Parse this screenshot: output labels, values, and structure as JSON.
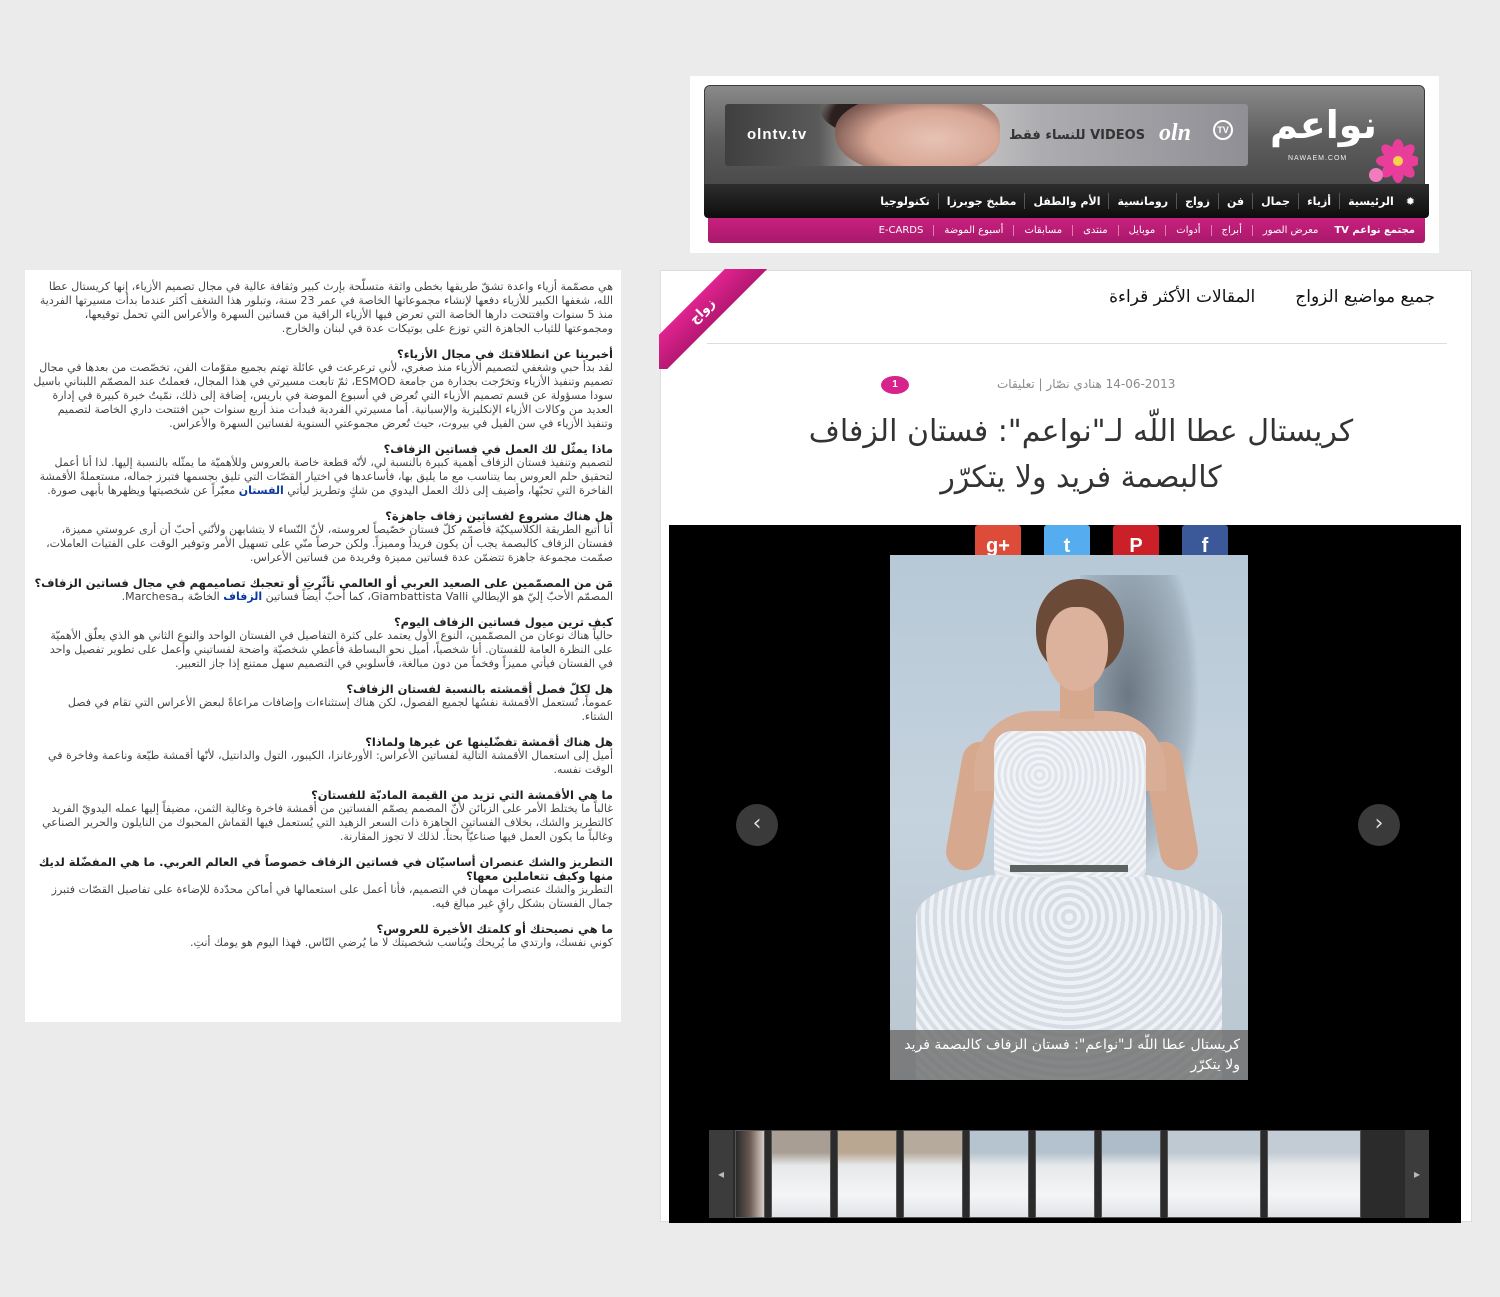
{
  "header": {
    "ad": {
      "site": "olntv.tv",
      "tagline": "VIDEOS للنساء فقط",
      "logo": "oln",
      "tv_badge": "TV"
    },
    "site_logo": "نواعم",
    "site_logo_sub": "NAWAEM.COM",
    "nav_main": [
      "الرئيسية",
      "أزياء",
      "جمال",
      "فن",
      "زواج",
      "رومانسية",
      "الأم والطفل",
      "مطبخ جوبرزا",
      "تكنولوجيا"
    ],
    "nav_sub": {
      "community": "مجتمع نواعم TV",
      "items": [
        "معرض الصور",
        "أبراج",
        "أدوات",
        "موبايل",
        "منتدى",
        "مسابقات",
        "أسبوع الموضة",
        "E-CARDS"
      ]
    }
  },
  "article_text": {
    "intro": "هي مصمّمة أزياء واعدة تشقّ طريقها بخطى واثقة متسلّحة بإرث كبير وثقافة عالية في مجال تصميم الأزياء، إنها كريستال عطا الله، شغفها الكبير للأزياء دفعها لإنشاء مجموعاتها الخاصة في عمر 23 سنة، وتبلور هذا الشغف أكثر عندما بدأت مسيرتها الفردية منذ 5 سنوات وافتتحت دارها الخاصة التي تعرض فيها الأزياء الراقية من فساتين السهرة والأعراس التي تحمل توقيعها، ومجموعتها للثياب الجاهزة التي توزع على بوتيكات عدة في لبنان والخارج.",
    "qa": [
      {
        "q": "أخبرينا عن انطلاقتك في مجال الأزياء؟",
        "a": "لقد بدأ حبي وشغفي لتصميم الأزياء منذ صغري، لأني ترعرعت في عائلة تهتم بجميع مقوّمات الفن، تخصّصت من بعدها في مجال تصميم وتنفيذ الأزياء وتخرّجت بجدارة من جامعة ESMOD، ثمّ تابعت مسيرتي في هذا المجال، فعملتُ عند المصمّم اللبناني باسيل سودا مسؤولة عن قسم تصميم الأزياء التي تُعرض في أسبوع الموضة في باريس، إضافة إلى ذلك، نمّيتُ خبرة كبيرة في إدارة العديد من وكالات الأزياء الإنكليزية والإسبانية. أما مسيرتي الفردية فبدأت منذ أربع سنوات حين افتتحت داري الخاصة لتصميم وتنفيذ الأزياء في سن الفيل في بيروت، حيث تُعرض مجموعتي السنوية لفساتين السهرة والأعراس."
      },
      {
        "q": "ماذا يمثّل لك العمل في فساتين الزفاف؟",
        "a": "لتصميم وتنفيذ فستان الزفاف أهمية كبيرة بالنسبة لي، لأنّه قطعة خاصة بالعروس وللأهميّة ما يمثّله بالنسبة إليها. لذا أنا أعمل لتحقيق حلم العروس بما يتناسب مع ما يليق بها، فأساعدها في اختيار القصّات التي تليق بجسمها فتبرز جماله، مستعملةً الأقمشة الفاخرة التي تحبّها، وأضيف إلى ذلك العمل اليدوي من شكٍ وتطريز ليأتي",
        "link": "الفستان",
        "a2": "معبّراً عن شخصيتها ويظهرها بأبهى صورة."
      },
      {
        "q": "هل هناك مشروع لفساتين زفاف جاهزة؟",
        "a": "أنا أتبع الطريقة الكلاسيكيّة فأصمّم كلّ فستان خصّيصاً لعروسته، لأنّ النّساء لا يتشابهن ولأنّني أحبّ أن أرى عروستي مميزة، ففستان الزفاف كالبصمة يجب أن يكون فريداً ومميزاً. ولكن حرصاً منّي على تسهيل الأمر وتوفير الوقت على الفتيات العاملات، صمّمت مجموعة جاهزة تتضمّن عدة فساتين مميزة وفريدة من فساتين الأعراس."
      },
      {
        "q": "مَن من المصمّمين على الصعيد العربي أو العالمي تأثّرتِ أو تعجبك تصاميمهم في مجال فساتين الزفاف؟",
        "a": "المصمّم الأحبّ إليّ هو الإيطالي Giambattista Valli، كما أحبّ أيضاً فساتين",
        "link": "الزفاف",
        "a2": "الخاصّة بـMarchesa."
      },
      {
        "q": "كيف ترين ميول فساتين الزفاف اليوم؟",
        "a": "حالياً هناك نوعان من المصمّمين، النوع الأول يعتمد على كثرة التفاصيل في الفستان الواحد والنوع الثاني هو الذي يعلّق الأهميّة على النظرة العامة للفستان. أنا شخصياً، أميل نحو البساطة فأعطي شخصيّة واضحة لفساتيني وأعمل على تطوير تفصيل واحد في الفستان فيأتي مميزاً وفخماً من دون مبالغة، فأسلوبي في التصميم سهل ممتنع إذا جاز التعبير."
      },
      {
        "q": "هل لكلّ فصل أقمشته بالنسبة لفستان الزفاف؟",
        "a": "عموماً، تُستعمل الأقمشة نفسُها لجميع الفصول، لكن هناك إستثناءات وإضافات مراعاةً لبعض الأعراس التي تقام في فصل الشتاء."
      },
      {
        "q": "هل هناك أقمشة تفضّلينها عن غيرها ولماذا؟",
        "a": "أميل إلى استعمال الأقمشة التالية لفساتين الأعراس: الأورغانزا، الكيبور، التول والدانتيل، لأنّها أقمشة طيّعة وناعمة وفاخرة في الوقت نفسه."
      },
      {
        "q": "ما هي الأقمشة التي تزيد من القيمة الماديّة للفستان؟",
        "a": "غالباً ما يختلط الأمر على الزبائن لأنّ المصمم يصمّم الفساتين من أقمشة فاخرة وغالية الثمن، مضيفاً إليها عمله اليدويّ الفريد كالتطريز والشك، بخلاف الفساتين الجاهزة ذات السعر الزهيد التي يُستعمل فيها القماش المحبوك من النايلون والحرير الصناعي وغالباً ما يكون العمل فيها صناعيّاً بحتاً. لذلك لا تجوز المقارنة."
      },
      {
        "q": "التطريز والشك عنصران أساسيّان في فساتين الزفاف خصوصاً في العالم العربي. ما هي المفضّلة لديك منها وكيف تتعاملين معها؟",
        "a": "التطريز والشك عنصرات مهمان في التصميم، فأنا أعمل على استعمالها في أماكن محدّدة للإضاءة على تفاصيل القصّات فتبرز جمال الفستان بشكل راقٍ غير مبالغ فيه."
      },
      {
        "q": "ما هي نصيحتك أو كلمتك الأخيرة للعروس؟",
        "a": "كوني نفسك، وارتدي ما يُريحك ويُناسب شخصيتك لا ما يُرضي النّاس. فهذا اليوم هو يومك أنتِ."
      }
    ]
  },
  "article_main": {
    "ribbon": "زواج",
    "tabs": [
      "المقالات الأكثر قراءة",
      "جميع مواضيع الزواج"
    ],
    "meta": "14-06-2013 هنادي نصّار | تعليقات",
    "comment_count": "1",
    "title": "كريستال عطا اللّه لـ\"نواعم\": فستان الزفاف كالبصمة فريد ولا يتكرّر",
    "share": [
      {
        "icon": "google-plus-icon",
        "glyph": "g+",
        "color": "#dd4b39"
      },
      {
        "icon": "twitter-icon",
        "glyph": "t",
        "color": "#55acee"
      },
      {
        "icon": "pinterest-icon",
        "glyph": "P",
        "color": "#cb2027"
      },
      {
        "icon": "facebook-icon",
        "glyph": "f",
        "color": "#3b5998"
      }
    ],
    "caption": "كريستال عطا اللّه لـ\"نواعم\": فستان الزفاف كالبصمة فريد ولا يتكرّر",
    "prev_glyph": "‹",
    "next_glyph": "›",
    "thumbs_prev_glyph": "◂",
    "thumbs_next_glyph": "▸"
  }
}
